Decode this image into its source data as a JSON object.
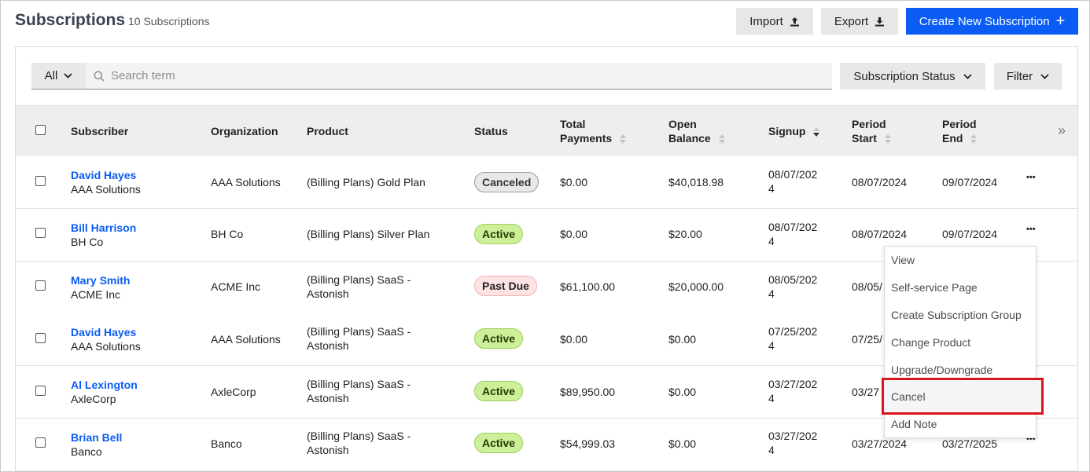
{
  "header": {
    "title": "Subscriptions",
    "count": "10 Subscriptions",
    "import_label": "Import",
    "export_label": "Export",
    "create_label": "Create New Subscription",
    "create_icon": "+"
  },
  "toolbar": {
    "scope_label": "All",
    "search_placeholder": "Search term",
    "status_label": "Subscription Status",
    "filter_label": "Filter"
  },
  "table": {
    "columns": {
      "subscriber": "Subscriber",
      "organization": "Organization",
      "product": "Product",
      "status": "Status",
      "total_payments_1": "Total",
      "total_payments_2": "Payments",
      "open_balance_1": "Open",
      "open_balance_2": "Balance",
      "signup": "Signup",
      "period_start_1": "Period",
      "period_start_2": "Start",
      "period_end_1": "Period",
      "period_end_2": "End"
    },
    "rows": [
      {
        "name": "David Hayes",
        "sub_org": "AAA Solutions",
        "organization": "AAA Solutions",
        "product_1": "(Billing Plans) Gold Plan",
        "product_2": "",
        "status": "Canceled",
        "total": "$0.00",
        "balance": "$40,018.98",
        "signup_1": "08/07/202",
        "signup_2": "4",
        "start": "08/07/2024",
        "end": "09/07/2024"
      },
      {
        "name": "Bill Harrison",
        "sub_org": "BH Co",
        "organization": "BH Co",
        "product_1": "(Billing Plans) Silver Plan",
        "product_2": "",
        "status": "Active",
        "total": "$0.00",
        "balance": "$20.00",
        "signup_1": "08/07/202",
        "signup_2": "4",
        "start": "08/07/2024",
        "end": "09/07/2024"
      },
      {
        "name": "Mary Smith",
        "sub_org": "ACME Inc",
        "organization": "ACME Inc",
        "product_1": "(Billing Plans) SaaS -",
        "product_2": "Astonish",
        "status": "Past Due",
        "total": "$61,100.00",
        "balance": "$20,000.00",
        "signup_1": "08/05/202",
        "signup_2": "4",
        "start": "08/05/",
        "end": ""
      },
      {
        "name": "David Hayes",
        "sub_org": "AAA Solutions",
        "organization": "AAA Solutions",
        "product_1": "(Billing Plans) SaaS -",
        "product_2": "Astonish",
        "status": "Active",
        "total": "$0.00",
        "balance": "$0.00",
        "signup_1": "07/25/202",
        "signup_2": "4",
        "start": "07/25/",
        "end": ""
      },
      {
        "name": "Al Lexington",
        "sub_org": "AxleCorp",
        "organization": "AxleCorp",
        "product_1": "(Billing Plans) SaaS -",
        "product_2": "Astonish",
        "status": "Active",
        "total": "$89,950.00",
        "balance": "$0.00",
        "signup_1": "03/27/202",
        "signup_2": "4",
        "start": "03/27",
        "end": ""
      },
      {
        "name": "Brian Bell",
        "sub_org": "Banco",
        "organization": "Banco",
        "product_1": "(Billing Plans) SaaS -",
        "product_2": "Astonish",
        "status": "Active",
        "total": "$54,999.03",
        "balance": "$0.00",
        "signup_1": "03/27/202",
        "signup_2": "4",
        "start": "03/27/2024",
        "end": "03/27/2025"
      }
    ],
    "more_icon": "•••",
    "expand_icon": "»"
  },
  "row_menu": {
    "items": [
      "View",
      "Self-service Page",
      "Create Subscription Group",
      "Change Product",
      "Upgrade/Downgrade",
      "Cancel",
      "Add Note"
    ],
    "highlighted": "Cancel"
  },
  "colors": {
    "accent": "#0a5cf5",
    "active_bg": "#cdef9a",
    "pastdue_bg": "#fde3e3",
    "canceled_bg": "#e8e8e8",
    "highlight_border": "#d9141f"
  }
}
